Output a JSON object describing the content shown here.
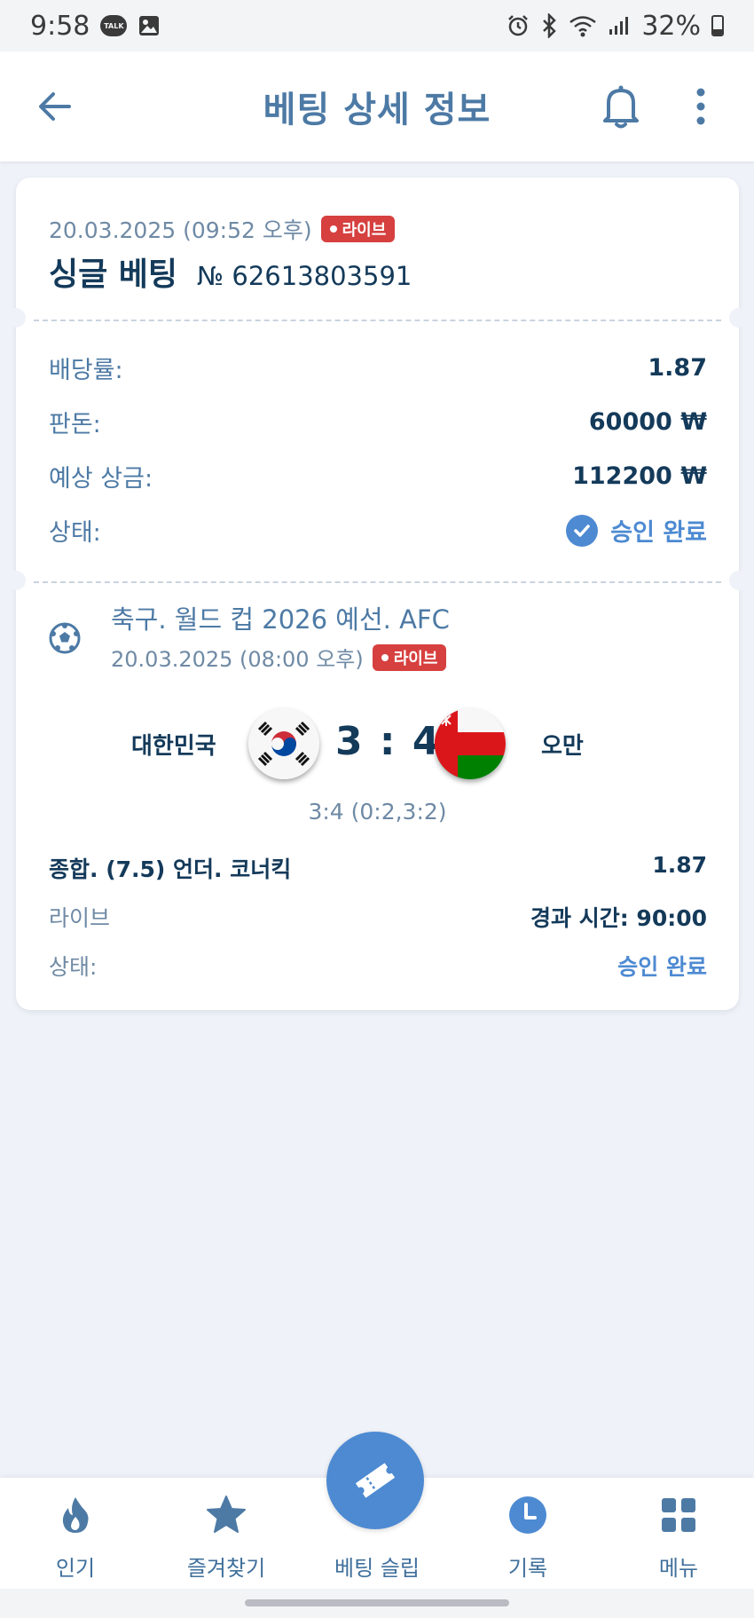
{
  "status_bar": {
    "time": "9:58",
    "talk_label": "TALK",
    "battery": "32%",
    "battery_level": 0.32
  },
  "header": {
    "title": "베팅 상세 정보"
  },
  "ticket": {
    "date": "20.03.2025 (09:52 오후)",
    "live_badge": "라이브",
    "bet_type": "싱글 베팅",
    "bet_number": "№ 62613803591",
    "odds_label": "배당률:",
    "odds_value": "1.87",
    "stake_label": "판돈:",
    "stake_value": "60000 ₩",
    "payout_label": "예상 상금:",
    "payout_value": "112200 ₩",
    "status_label": "상태:",
    "status_value": "승인 완료"
  },
  "event": {
    "title": "축구. 월드 컵 2026 예선. AFC",
    "date": "20.03.2025 (08:00 오후)",
    "live_badge": "라이브",
    "home_team": "대한민국",
    "away_team": "오만",
    "score": "3 : 4",
    "score_detail": "3:4 (0:2,3:2)",
    "market": "종합. (7.5) 언더. 코너킥",
    "market_odds": "1.87",
    "mode": "라이브",
    "elapsed": "경과 시간: 90:00",
    "status_label": "상태:",
    "status_value": "승인 완료"
  },
  "nav": {
    "items": [
      {
        "label": "인기",
        "icon": "fire-icon"
      },
      {
        "label": "즐겨찾기",
        "icon": "star-icon"
      },
      {
        "label": "베팅 슬립",
        "icon": "ticket-icon"
      },
      {
        "label": "기록",
        "icon": "clock-icon"
      },
      {
        "label": "메뉴",
        "icon": "grid-icon"
      }
    ]
  },
  "colors": {
    "accent": "#4d8ad2",
    "title": "#4d7aa5",
    "text_dark": "#143a5a",
    "live": "#d6403f",
    "background": "#eff2f8"
  }
}
